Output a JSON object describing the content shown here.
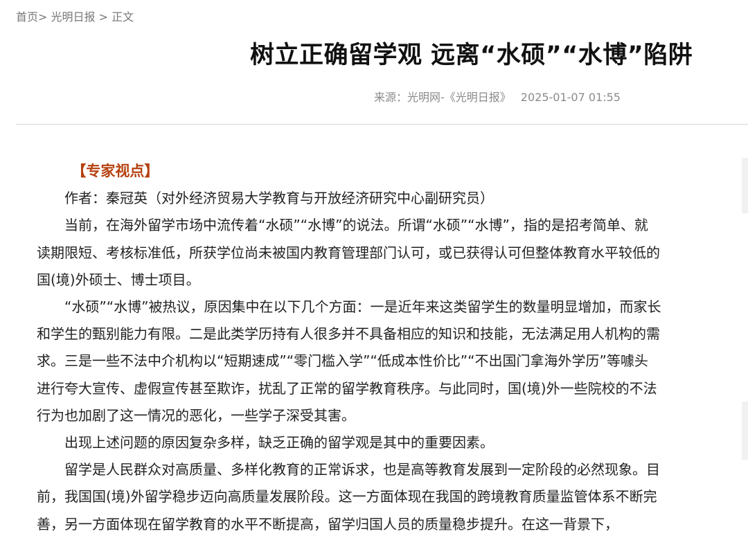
{
  "breadcrumb": {
    "home": "首页",
    "sep1": ">",
    "channel": "光明日报",
    "sep2": ">",
    "current": "正文"
  },
  "article": {
    "title": "树立正确留学观 远离“水硕”“水博”陷阱",
    "source": "来源：光明网-《光明日报》",
    "date": "2025-01-07 01:55",
    "section_label": "【专家视点】",
    "paragraphs": [
      "作者：秦冠英（对外经济贸易大学教育与开放经济研究中心副研究员）",
      "当前，在海外留学市场中流传着“水硕”“水博”的说法。所谓“水硕”“水博”，指的是招考简单、就读期限短、考核标准低，所获学位尚未被国内教育管理部门认可，或已获得认可但整体教育水平较低的国(境)外硕士、博士项目。",
      "“水硕”“水博”被热议，原因集中在以下几个方面：一是近年来这类留学生的数量明显增加，而家长和学生的甄别能力有限。二是此类学历持有人很多并不具备相应的知识和技能，无法满足用人机构的需求。三是一些不法中介机构以“短期速成”“零门槛入学”“低成本性价比”“不出国门拿海外学历”等噱头进行夸大宣传、虚假宣传甚至欺诈，扰乱了正常的留学教育秩序。与此同时，国(境)外一些院校的不法行为也加剧了这一情况的恶化，一些学子深受其害。",
      "出现上述问题的原因复杂多样，缺乏正确的留学观是其中的重要因素。",
      "留学是人民群众对高质量、多样化教育的正常诉求，也是高等教育发展到一定阶段的必然现象。目前，我国国(境)外留学稳步迈向高质量发展阶段。这一方面体现在我国的跨境教育质量监管体系不断完善，另一方面体现在留学教育的水平不断提高，留学归国人员的质量稳步提升。在这一背景下，"
    ]
  }
}
